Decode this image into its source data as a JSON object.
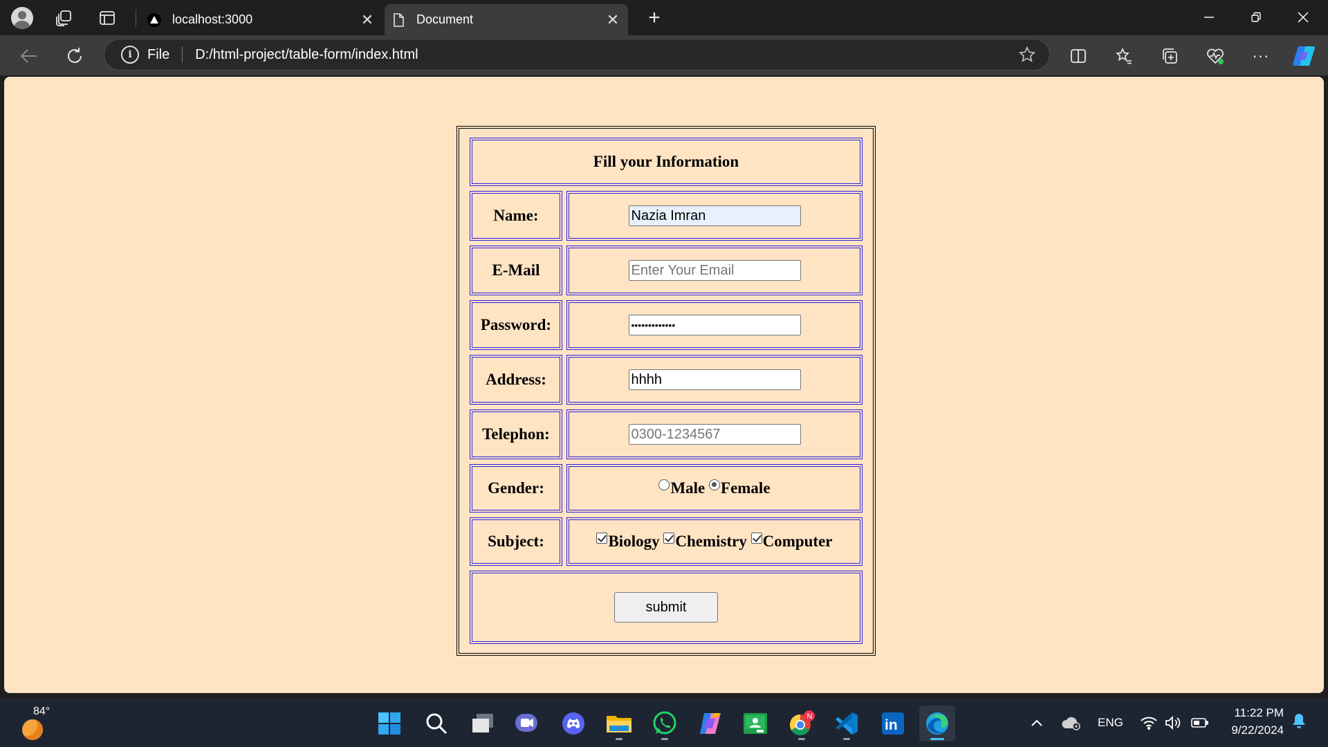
{
  "browser": {
    "tabs": [
      {
        "title": "localhost:3000",
        "active": false
      },
      {
        "title": "Document",
        "active": true
      }
    ],
    "address": {
      "scheme_label": "File",
      "url": "D:/html-project/table-form/index.html"
    }
  },
  "form": {
    "heading": "Fill your Information",
    "name": {
      "label": "Name:",
      "value": "Nazia Imran"
    },
    "email": {
      "label": "E-Mail",
      "placeholder": "Enter Your Email"
    },
    "password": {
      "label": "Password:",
      "masked": "•••••••••••••"
    },
    "address": {
      "label": "Address:",
      "value": "hhhh"
    },
    "telephone": {
      "label": "Telephon:",
      "placeholder": "0300-1234567"
    },
    "gender": {
      "label": "Gender:",
      "options": [
        "Male",
        "Female"
      ],
      "selected": "Female"
    },
    "subject": {
      "label": "Subject:",
      "options": [
        "Biology",
        "Chemistry",
        "Computer"
      ],
      "checked": [
        "Biology",
        "Chemistry",
        "Computer"
      ]
    },
    "submit_label": "submit"
  },
  "taskbar": {
    "weather_temp": "84°",
    "apps": [
      "start-icon",
      "search-icon",
      "task-view-icon",
      "teams-icon",
      "discord-icon",
      "file-explorer-icon",
      "whatsapp-icon",
      "copilot-icon",
      "classroom-icon",
      "chrome-icon",
      "vscode-icon",
      "linkedin-icon",
      "edge-icon"
    ],
    "language": "ENG",
    "time": "11:22 PM",
    "date": "9/22/2024"
  },
  "colors": {
    "page_background": "#ffe4c4",
    "table_border": "#2b1fe0",
    "taskbar": "#1e2532"
  }
}
